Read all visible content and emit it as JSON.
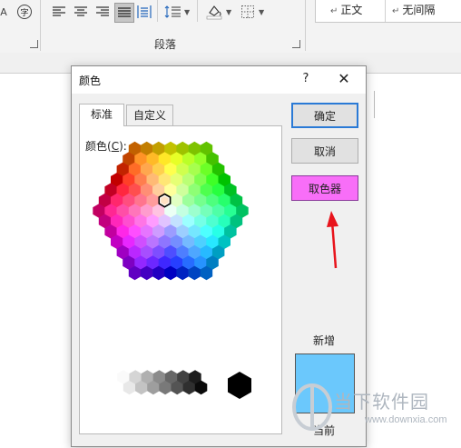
{
  "ribbon": {
    "font_icon_a": "A",
    "char_icon": "字",
    "paragraph_group_label": "段落",
    "styles": [
      "正文",
      "无间隔"
    ],
    "style_mark": "↵"
  },
  "dialog": {
    "title": "颜色",
    "help_label": "?",
    "close_label": "✕",
    "tabs": [
      {
        "label": "标准",
        "selected": true
      },
      {
        "label": "自定义",
        "selected": false
      }
    ],
    "colors_label_prefix": "颜色(",
    "colors_label_accel": "C",
    "colors_label_suffix": "):",
    "buttons": {
      "ok": "确定",
      "cancel": "取消",
      "picker": "取色器"
    },
    "new_label": "新增",
    "current_label": "当前",
    "new_color": "#6bc8fc",
    "picker_highlight_color": "#f86ef8",
    "annotation_arrow_color": "#e8141c"
  },
  "watermark": {
    "text": "当下软件园",
    "url": "www.downxia.com"
  }
}
